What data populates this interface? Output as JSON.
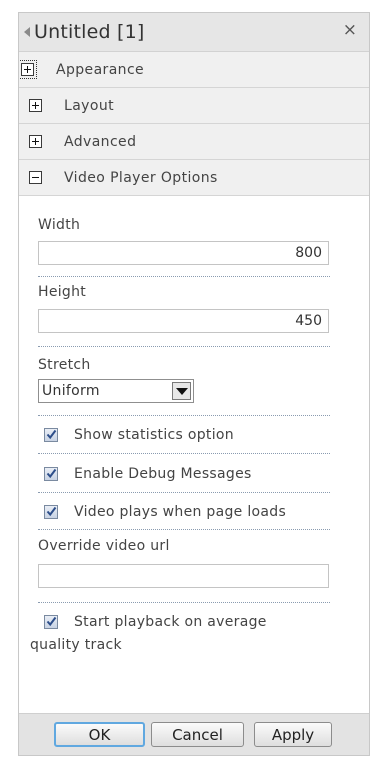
{
  "window": {
    "title": "Untitled [1]",
    "close_symbol": "×"
  },
  "sections": [
    {
      "label": "Appearance",
      "state": "collapsed"
    },
    {
      "label": "Layout",
      "state": "collapsed"
    },
    {
      "label": "Advanced",
      "state": "collapsed"
    },
    {
      "label": "Video Player Options",
      "state": "expanded"
    }
  ],
  "video_player_options": {
    "width": {
      "label": "Width",
      "value": "800"
    },
    "height": {
      "label": "Height",
      "value": "450"
    },
    "stretch": {
      "label": "Stretch",
      "selected": "Uniform"
    },
    "show_statistics": {
      "label": "Show statistics option",
      "checked": true
    },
    "enable_debug": {
      "label": "Enable Debug Messages",
      "checked": true
    },
    "autoplay": {
      "label": "Video plays when page loads",
      "checked": true
    },
    "override_url": {
      "label": "Override video url",
      "value": ""
    },
    "average_quality": {
      "label_line1": "Start playback on average",
      "label_line2": "quality track",
      "checked": true
    }
  },
  "footer": {
    "ok_label": "OK",
    "cancel_label": "Cancel",
    "apply_label": "Apply"
  },
  "colors": {
    "titlebar": "#e6e6e6",
    "section_header": "#f0f0f0",
    "ok_focus_border": "#60a8e0",
    "check_mark": "#2d4e8a"
  },
  "icons": {
    "back": "left-arrow-icon",
    "close": "close-icon",
    "collapsed": "plus-icon",
    "expanded": "minus-icon",
    "dropdown": "chevron-down-icon",
    "checkbox": "checkmark-icon"
  }
}
